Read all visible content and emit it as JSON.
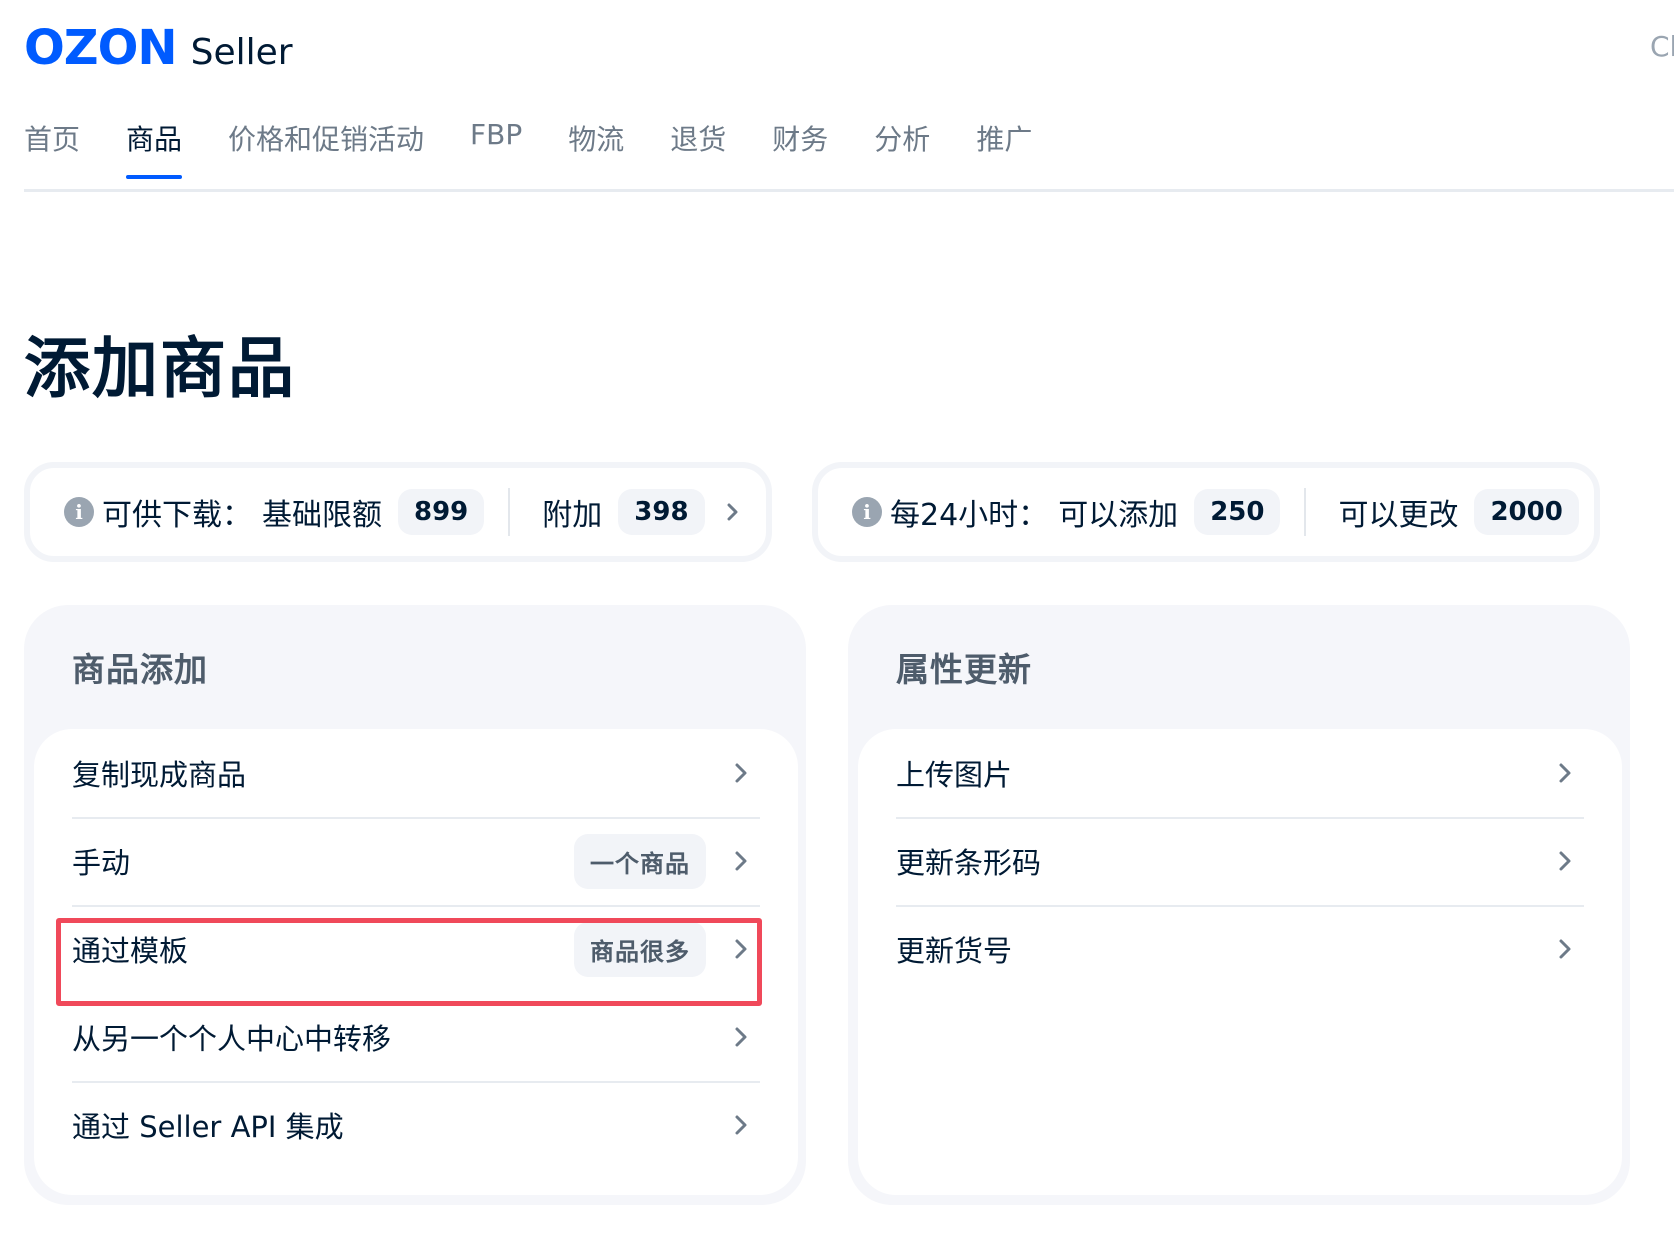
{
  "header": {
    "logo": {
      "brand": "OZON",
      "product": "Seller"
    },
    "corner_text": "Cl"
  },
  "nav": {
    "items": [
      {
        "label": "首页",
        "active": false
      },
      {
        "label": "商品",
        "active": true
      },
      {
        "label": "价格和促销活动",
        "active": false
      },
      {
        "label": "FBP",
        "active": false
      },
      {
        "label": "物流",
        "active": false
      },
      {
        "label": "退货",
        "active": false
      },
      {
        "label": "财务",
        "active": false
      },
      {
        "label": "分析",
        "active": false
      },
      {
        "label": "推广",
        "active": false
      }
    ]
  },
  "page": {
    "title": "添加商品"
  },
  "quota_download": {
    "icon": "info-icon",
    "label": "可供下载：",
    "base_label": "基础限额",
    "base_value": "899",
    "extra_label": "附加",
    "extra_value": "398"
  },
  "quota_daily": {
    "icon": "info-icon",
    "label": "每24小时：",
    "add_label": "可以添加",
    "add_value": "250",
    "change_label": "可以更改",
    "change_value": "2000"
  },
  "card_add": {
    "title": "商品添加",
    "items": [
      {
        "label": "复制现成商品",
        "badge": ""
      },
      {
        "label": "手动",
        "badge": "一个商品"
      },
      {
        "label": "通过模板",
        "badge": "商品很多",
        "highlighted": true
      },
      {
        "label": "从另一个个人中心中转移",
        "badge": ""
      },
      {
        "label": "通过 Seller API 集成",
        "badge": ""
      }
    ]
  },
  "card_update": {
    "title": "属性更新",
    "items": [
      {
        "label": "上传图片"
      },
      {
        "label": "更新条形码"
      },
      {
        "label": "更新货号"
      }
    ]
  },
  "colors": {
    "brand": "#005bff",
    "highlight": "#f0495a",
    "card_bg": "#f5f6fa",
    "badge_bg": "#f2f4f8",
    "text_primary": "#001a34",
    "text_secondary": "#6d7a88"
  }
}
